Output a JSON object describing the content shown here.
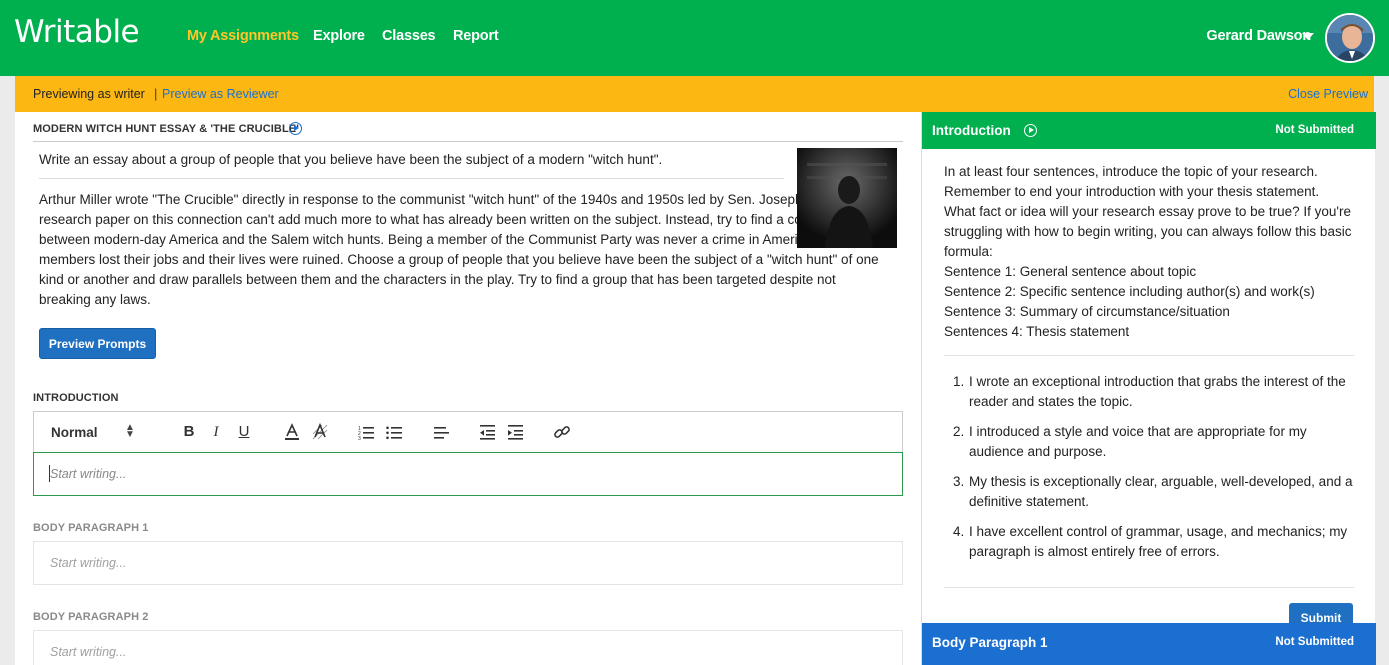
{
  "nav": {
    "logo": "Writable",
    "links": [
      "My Assignments",
      "Explore",
      "Classes",
      "Report"
    ],
    "user_name": "Gerard Dawson"
  },
  "preview_bar": {
    "writer_label": "Previewing as writer",
    "separator": "|",
    "reviewer_link": "Preview as Reviewer",
    "close_link": "Close Preview"
  },
  "assignment": {
    "title": "MODERN WITCH HUNT ESSAY & 'THE CRUCIBLE'",
    "prompt_line1": "Write an essay about a group of people that you believe have been the subject of a modern \"witch hunt\".",
    "prompt_body": "Arthur Miller wrote \"The Crucible\" directly in response to the communist \"witch hunt\" of the 1940s and 1950s led by Sen. Joseph McCarthy. A research paper on this connection can't add much more to what has already been written on the subject. Instead, try to find a connection between modern-day America and the Salem witch hunts. Being a member of the Communist Party was never a crime in America, yet many members lost their jobs and their lives were ruined. Choose a group of people that you believe have been the subject of a \"witch hunt\" of one kind or another and draw parallels between them and the characters in the play. Try to find a group that has been targeted despite not breaking any laws.",
    "preview_prompts_button": "Preview Prompts"
  },
  "sections": [
    {
      "label": "INTRODUCTION",
      "placeholder": "Start writing..."
    },
    {
      "label": "BODY PARAGRAPH 1",
      "placeholder": "Start writing..."
    },
    {
      "label": "BODY PARAGRAPH 2",
      "placeholder": "Start writing..."
    }
  ],
  "toolbar": {
    "format_select": "Normal"
  },
  "right_panel": {
    "section_title": "Introduction",
    "status": "Not Submitted",
    "instructions": [
      "In at least four sentences, introduce the topic of your research. Remember to end your introduction with your thesis statement. What fact or idea will your research essay prove to be true? If you're struggling with how to begin writing, you can always follow this basic formula:",
      "Sentence 1: General sentence about topic",
      "Sentence 2: Specific sentence including author(s) and work(s)",
      "Sentence 3: Summary of circumstance/situation",
      "Sentences 4: Thesis statement"
    ],
    "criteria": [
      {
        "num": "1.",
        "text": "I wrote an exceptional introduction that grabs the interest of the reader and states the topic."
      },
      {
        "num": "2.",
        "text": "I introduced a style and voice that are appropriate for my audience and purpose."
      },
      {
        "num": "3.",
        "text": "My thesis is exceptionally clear, arguable, well-developed, and a definitive statement."
      },
      {
        "num": "4.",
        "text": "I have excellent control of grammar, usage, and mechanics; my paragraph is almost entirely free of errors."
      }
    ],
    "submit_button": "Submit",
    "next_section_title": "Body Paragraph 1",
    "next_section_status": "Not Submitted"
  },
  "colors": {
    "brand_green": "#00b04f",
    "active_yellow": "#ffc629",
    "preview_bar": "#fcb712",
    "link_blue": "#1a6fd1"
  }
}
